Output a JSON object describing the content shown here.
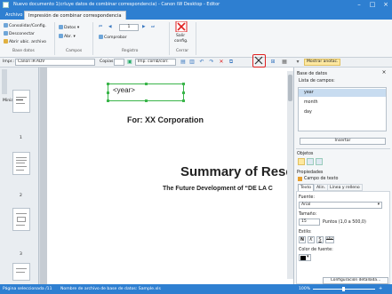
{
  "window": {
    "title": "Nuevo documento 1(crluye datos de combinar correspondencia) - Canon iW Desktop - Editor"
  },
  "menu_tabs": [
    "Archivo",
    "Impresión de combinar correspondencia"
  ],
  "ribbon": {
    "buttons": {
      "consolidar": "Consolidar/Config.",
      "desconectar": "Desconectar",
      "abrir_ubic": "Abrir ubic. archivo",
      "datos": "Datos",
      "abr": "Abr.",
      "comprobar": "Comprobar",
      "salir": "Salir",
      "config": "config."
    },
    "record_value": "1",
    "groups": [
      "Base datos",
      "Campos",
      "Registro",
      "Cerrar"
    ]
  },
  "toolbar": {
    "impr_label": "Impr.:",
    "printer": "Canon iR-ADV",
    "copias_label": "Copias",
    "mode": "Imp. cornb/corr.",
    "mostrar": "Mostrar anotac."
  },
  "left_pane": {
    "header": "Miniaturas",
    "page_numbers": [
      "1",
      "2",
      "3"
    ]
  },
  "document": {
    "field_tag": "<year>",
    "for_line": "For: XX Corporation",
    "summary": "Summary of Rese",
    "subtitle": "The Future Development of “DE LA C"
  },
  "right_pane": {
    "db_title": "Base de datos",
    "field_list_label": "Lista de campos:",
    "fields": [
      "year",
      "month",
      "day"
    ],
    "insert_button": "Insertar",
    "objects_title": "Objetos",
    "props_title": "Propiedades",
    "text_field": "Campo de texto",
    "prop_tabs": [
      "Texto",
      "Alin.",
      "Línea y relleno"
    ],
    "font_label": "Fuente:",
    "font_value": "Arial",
    "size_label": "Tamaño:",
    "size_value": "15",
    "size_units": "Puntos (1,0 a 500,0)",
    "style_label": "Estilo:",
    "style_buttons": [
      "N",
      "K",
      "S",
      "abc"
    ],
    "font_color_label": "Color de fuente:",
    "detail_button": "Configuración detallada..."
  },
  "status": {
    "page_sel": "Página seleccionada /11",
    "db_name": "Nombre de archivo de base de datos: Sample.xls",
    "zoom": "100%"
  },
  "colors": {
    "titlebar": "#2e7fd1",
    "highlight_red": "#e02020",
    "field_box_green": "#3ab54a"
  }
}
